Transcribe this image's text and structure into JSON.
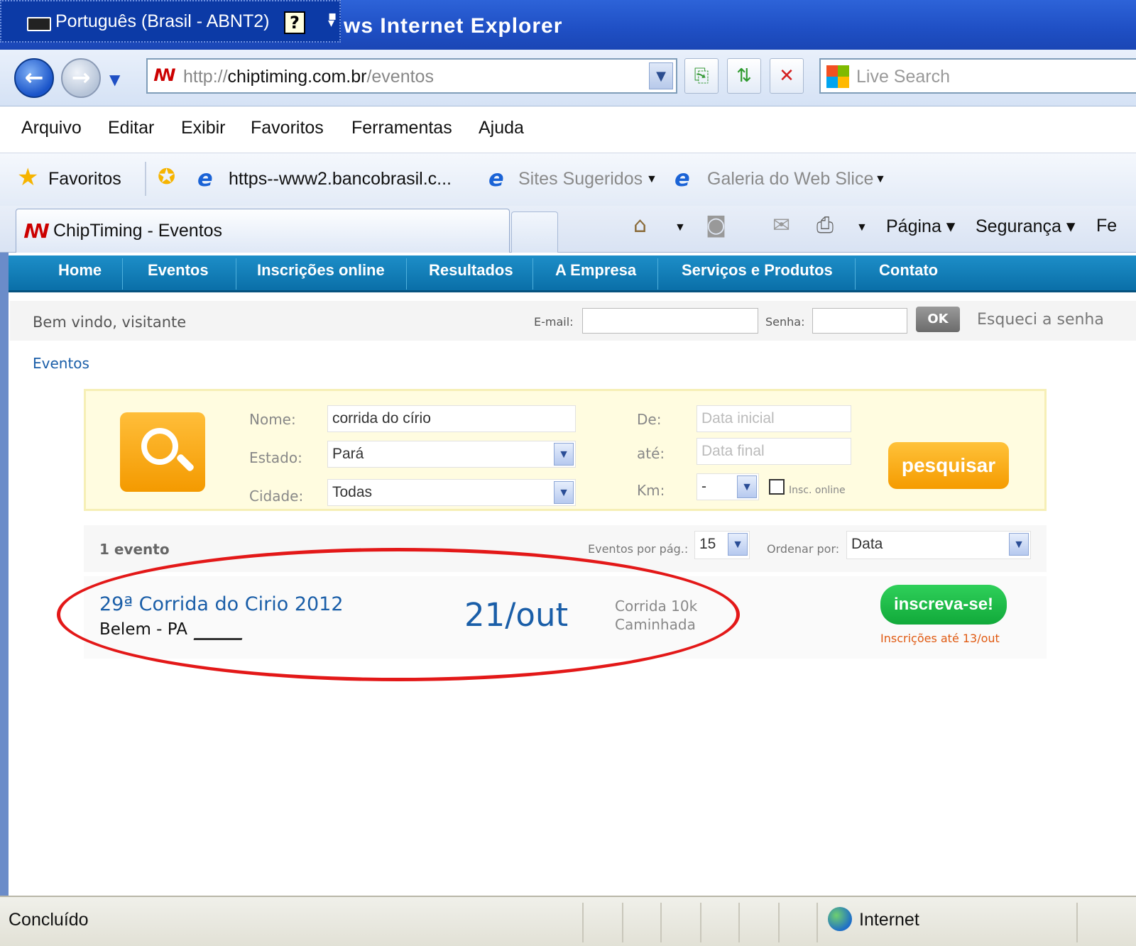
{
  "window": {
    "title": "ws Internet Explorer",
    "language_bar": "Português (Brasil - ABNT2)",
    "help_icon": "?"
  },
  "address": {
    "url_prefix": "http://",
    "url_host": "chiptiming.com.br",
    "url_path": "/eventos",
    "search_placeholder": "Live Search"
  },
  "menu": [
    "Arquivo",
    "Editar",
    "Exibir",
    "Favoritos",
    "Ferramentas",
    "Ajuda"
  ],
  "favorites_bar": {
    "favorites_label": "Favoritos",
    "items": [
      "https--www2.bancobrasil.c...",
      "Sites Sugeridos",
      "Galeria do Web Slice"
    ]
  },
  "tab": {
    "title": "ChipTiming - Eventos"
  },
  "command_bar": [
    "Página",
    "Segurança",
    "Fe"
  ],
  "site_nav": [
    "Home",
    "Eventos",
    "Inscrições online",
    "Resultados",
    "A Empresa",
    "Serviços e Produtos",
    "Contato"
  ],
  "login": {
    "welcome": "Bem vindo, visitante",
    "email_label": "E-mail:",
    "password_label": "Senha:",
    "ok": "OK",
    "forgot": "Esqueci a senha"
  },
  "breadcrumb": "Eventos",
  "search_form": {
    "name_label": "Nome:",
    "name_value": "corrida do círio",
    "state_label": "Estado:",
    "state_value": "Pará",
    "city_label": "Cidade:",
    "city_value": "Todas",
    "from_label": "De:",
    "from_placeholder": "Data inicial",
    "to_label": "até:",
    "to_placeholder": "Data final",
    "km_label": "Km:",
    "km_value": "-",
    "online_label": "Insc. online",
    "submit": "pesquisar"
  },
  "results": {
    "count": "1 evento",
    "per_page_label": "Eventos por pág.:",
    "per_page_value": "15",
    "order_label": "Ordenar por:",
    "order_value": "Data",
    "items": [
      {
        "title": "29ª Corrida do Cirio 2012",
        "city": "Belem - PA",
        "date": "21/out",
        "modality_1": "Corrida 10k",
        "modality_2": "Caminhada",
        "button": "inscreva-se!",
        "deadline": "Inscrições até 13/out"
      }
    ]
  },
  "status": {
    "text": "Concluído",
    "zone": "Internet"
  },
  "colors": {
    "ie_titlebar": "#1f4fc4",
    "site_nav": "#0a6fa8",
    "search_button": "#f59b00",
    "signup_button": "#11a93a",
    "highlight_oval": "#e31818",
    "link_blue": "#1a5ea8"
  }
}
